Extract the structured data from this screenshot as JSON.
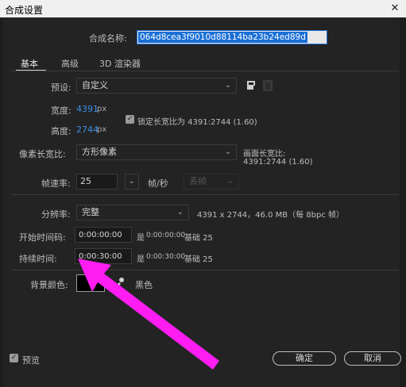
{
  "window": {
    "title": "合成设置",
    "close_glyph": "✕"
  },
  "composition_name": {
    "label": "合成名称:",
    "value": "064d8cea3f9010d88114ba23b24ed89d"
  },
  "tabs": [
    {
      "label": "基本",
      "active": true
    },
    {
      "label": "高级",
      "active": false
    },
    {
      "label": "3D 渲染器",
      "active": false
    }
  ],
  "preset": {
    "label": "预设:",
    "value": "自定义"
  },
  "width": {
    "label": "宽度:",
    "value": "4391",
    "unit": "px"
  },
  "height": {
    "label": "高度:",
    "value": "2744",
    "unit": "px"
  },
  "lock_aspect": {
    "label": "锁定长宽比为 4391:2744 (1.60)",
    "checked": true
  },
  "pixel_aspect": {
    "label": "像素长宽比:",
    "value": "方形像素"
  },
  "frame_aspect": {
    "label": "画面长宽比:",
    "value": "4391:2744 (1.60)"
  },
  "frame_rate": {
    "label": "帧速率:",
    "value": "25",
    "unit": "帧/秒",
    "drop_frame": "丢帧"
  },
  "resolution": {
    "label": "分辨率:",
    "value": "完整",
    "info": "4391 x 2744，46.0 MB（每 8bpc 帧）"
  },
  "start_timecode": {
    "label": "开始时间码:",
    "value": "0:00:00:00",
    "info_prefix": "是",
    "info_value": "0:00:00:00",
    "info_base": "基础 25"
  },
  "duration": {
    "label": "持续时间:",
    "value": "0:00:30:00",
    "info_prefix": "是",
    "info_value": "0:00:30:00",
    "info_base": "基础 25"
  },
  "background": {
    "label": "背景颜色:",
    "color_name": "黑色",
    "swatch_color": "#000000"
  },
  "preview": {
    "label": "预览",
    "checked": true
  },
  "buttons": {
    "ok": "确定",
    "cancel": "取消"
  },
  "annotation": {
    "arrow_color": "#ff1df2"
  }
}
